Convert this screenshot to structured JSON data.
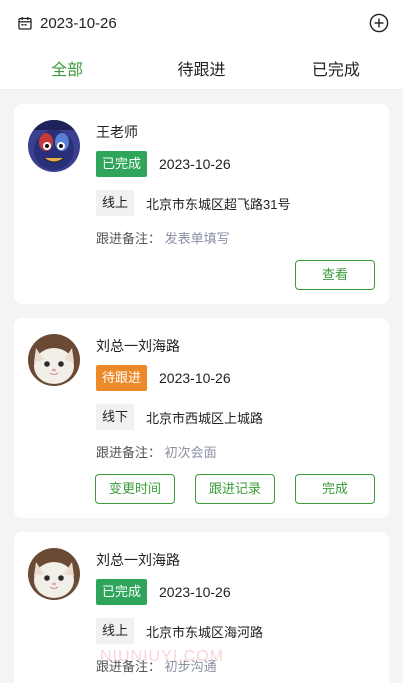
{
  "header": {
    "date": "2023-10-26"
  },
  "tabs": [
    {
      "label": "全部",
      "active": true
    },
    {
      "label": "待跟进",
      "active": false
    },
    {
      "label": "已完成",
      "active": false
    }
  ],
  "cards": [
    {
      "name": "王老师",
      "status": "已完成",
      "status_color": "#2ea55a",
      "date": "2023-10-26",
      "type": "线上",
      "address": "北京市东城区超飞路31号",
      "note_label": "跟进备注：",
      "note": "发表单填写",
      "actions": [
        "查看"
      ]
    },
    {
      "name": "刘总一刘海路",
      "status": "待跟进",
      "status_color": "#ec8a2a",
      "date": "2023-10-26",
      "type": "线下",
      "address": "北京市西城区上城路",
      "note_label": "跟进备注：",
      "note": "初次会面",
      "actions": [
        "变更时间",
        "跟进记录",
        "完成"
      ]
    },
    {
      "name": "刘总一刘海路",
      "status": "已完成",
      "status_color": "#2ea55a",
      "date": "2023-10-26",
      "type": "线上",
      "address": "北京市东城区海河路",
      "note_label": "跟进备注：",
      "note": "初步沟通"
    }
  ],
  "watermark": "NIUNIUYI.COM",
  "colors": {
    "accent": "#3a9c3a",
    "done": "#2ea55a",
    "pending": "#ec8a2a"
  }
}
